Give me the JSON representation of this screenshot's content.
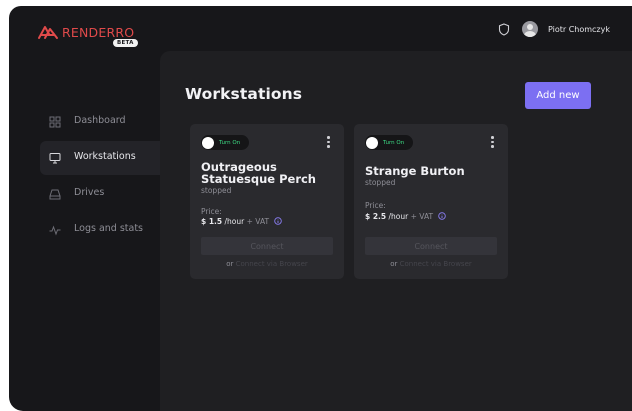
{
  "app": {
    "brand": "RENDERRO",
    "badge": "BETA",
    "brand_color": "#e04a4a",
    "accent_color": "#7c6ff2"
  },
  "header": {
    "user_name": "Piotr Chomczyk",
    "icons": [
      "shield-icon",
      "avatar"
    ]
  },
  "sidebar": {
    "items": [
      {
        "label": "Dashboard",
        "icon": "grid-icon",
        "active": false
      },
      {
        "label": "Workstations",
        "icon": "monitor-icon",
        "active": true
      },
      {
        "label": "Drives",
        "icon": "drive-icon",
        "active": false
      },
      {
        "label": "Logs and stats",
        "icon": "activity-icon",
        "active": false
      }
    ]
  },
  "main": {
    "title": "Workstations",
    "add_button": "Add new",
    "cards": [
      {
        "toggle_label": "Turn On",
        "name": "Outrageous Statuesque Perch",
        "status": "stopped",
        "price_label": "Price:",
        "price_value": "$ 1.5",
        "price_unit": "/hour",
        "price_vat": "+ VAT",
        "connect_label": "Connect",
        "or_text": "or",
        "browser_link": "Connect via Browser"
      },
      {
        "toggle_label": "Turn On",
        "name": "Strange Burton",
        "status": "stopped",
        "price_label": "Price:",
        "price_value": "$ 2.5",
        "price_unit": "/hour",
        "price_vat": "+ VAT",
        "connect_label": "Connect",
        "or_text": "or",
        "browser_link": "Connect via Browser"
      }
    ]
  }
}
